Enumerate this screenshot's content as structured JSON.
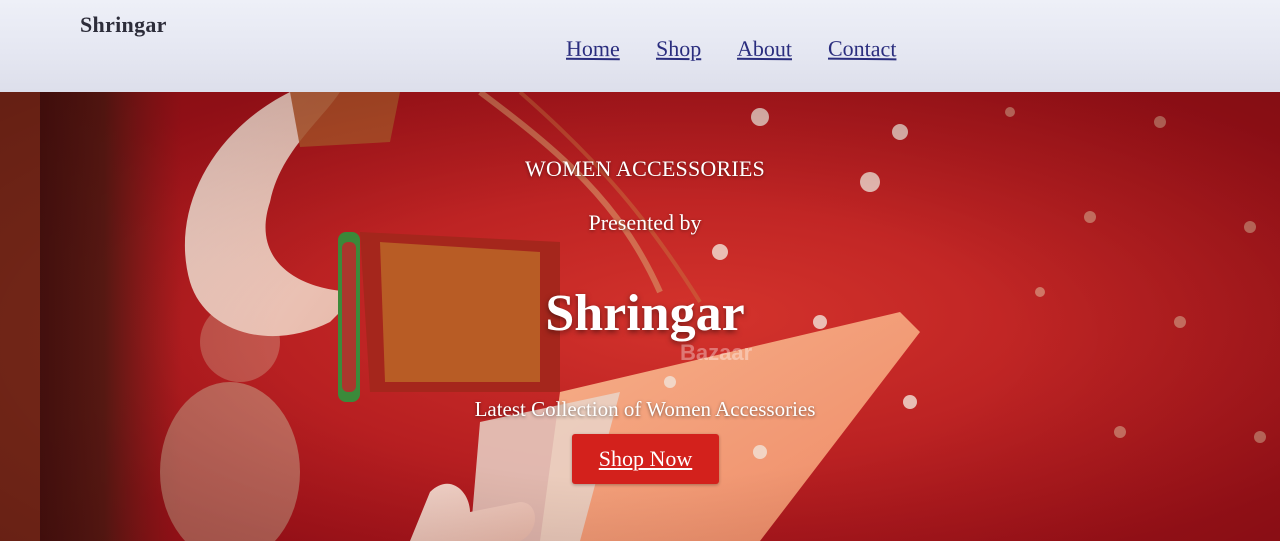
{
  "header": {
    "brand": "Shringar",
    "nav": [
      {
        "label": "Home"
      },
      {
        "label": "Shop"
      },
      {
        "label": "About"
      },
      {
        "label": "Contact"
      }
    ]
  },
  "hero": {
    "eyebrow": "WOMEN ACCESSORIES",
    "presented_by": "Presented by",
    "title": "Shringar",
    "watermark": "Bazaar",
    "tagline": "Latest Collection of Women Accessories",
    "cta_label": "Shop Now"
  },
  "colors": {
    "hero_red": "#b0141c",
    "cta_red": "#d3211c",
    "nav_link": "#2a2d7e"
  }
}
